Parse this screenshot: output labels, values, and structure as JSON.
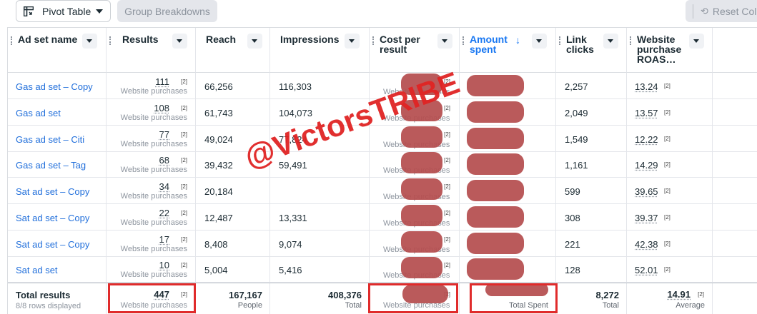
{
  "toolbar": {
    "pivot_label": "Pivot Table",
    "group_label": "Group Breakdowns",
    "reset_label": "Reset Colu"
  },
  "columns": {
    "ad_set_name": "Ad set name",
    "results": "Results",
    "reach": "Reach",
    "impressions": "Impressions",
    "cost_per_result": "Cost per result",
    "amount_spent": "Amount spent",
    "link_clicks": "Link clicks",
    "website_roas": "Website purchase ROAS…"
  },
  "results_sub": "Website purchases",
  "tag": "[2]",
  "rows": [
    {
      "name": "Gas ad set – Copy",
      "results": "111",
      "reach": "66,256",
      "impressions": "116,303",
      "link_clicks": "2,257",
      "roas": "13.24"
    },
    {
      "name": "Gas ad set",
      "results": "108",
      "reach": "61,743",
      "impressions": "104,073",
      "link_clicks": "2,049",
      "roas": "13.57"
    },
    {
      "name": "Gas ad set – Citi",
      "results": "77",
      "reach": "49,024",
      "impressions": "77,824",
      "link_clicks": "1,549",
      "roas": "12.22"
    },
    {
      "name": "Gas ad set – Tag",
      "results": "68",
      "reach": "39,432",
      "impressions": "59,491",
      "link_clicks": "1,161",
      "roas": "14.29"
    },
    {
      "name": "Sat ad set – Copy",
      "results": "34",
      "reach": "20,184",
      "impressions": "",
      "link_clicks": "599",
      "roas": "39.65"
    },
    {
      "name": "Sat ad set – Copy",
      "results": "22",
      "reach": "12,487",
      "impressions": "13,331",
      "link_clicks": "308",
      "roas": "39.37"
    },
    {
      "name": "Sat ad set – Copy",
      "results": "17",
      "reach": "8,408",
      "impressions": "9,074",
      "link_clicks": "221",
      "roas": "42.38"
    },
    {
      "name": "Sat ad set",
      "results": "10",
      "reach": "5,004",
      "impressions": "5,416",
      "link_clicks": "128",
      "roas": "52.01"
    }
  ],
  "totals": {
    "label": "Total results",
    "rows_displayed": "8/8 rows displayed",
    "results": "447",
    "results_sub": "Website purchases",
    "reach": "167,167",
    "reach_cap": "People",
    "impressions": "408,376",
    "impressions_cap": "Total",
    "cpr_sub": "Website purchases",
    "amount_cap": "Total Spent",
    "link_clicks": "8,272",
    "link_clicks_cap": "Total",
    "roas": "14.91",
    "roas_cap": "Average"
  },
  "watermark": "@VictorsTRIBE",
  "colors": {
    "link": "#216fdb",
    "sorted_header": "#1877f2",
    "highlight": "#e02b2b",
    "redaction": "#b54d4f"
  }
}
